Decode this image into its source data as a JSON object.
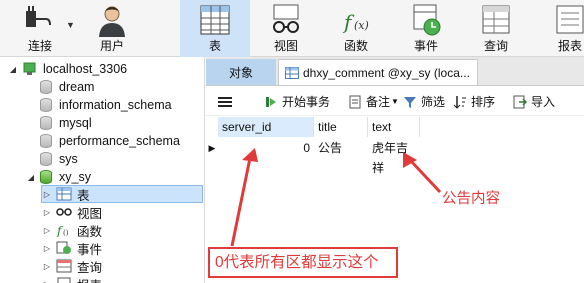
{
  "toolbar": {
    "buttons": [
      {
        "label": "连接",
        "icon": "plug-icon"
      },
      {
        "label": "用户",
        "icon": "user-icon"
      },
      {
        "label": "表",
        "icon": "table-icon"
      },
      {
        "label": "视图",
        "icon": "view-glasses-icon"
      },
      {
        "label": "函数",
        "icon": "function-icon"
      },
      {
        "label": "事件",
        "icon": "event-clock-icon"
      },
      {
        "label": "查询",
        "icon": "query-icon"
      },
      {
        "label": "报表",
        "icon": "report-icon"
      }
    ],
    "active": "表"
  },
  "tree": {
    "connection": "localhost_3306",
    "databases": [
      "dream",
      "information_schema",
      "mysql",
      "performance_schema",
      "sys",
      "xy_sy"
    ],
    "xy_sy_children": [
      "表",
      "视图",
      "函数",
      "事件",
      "查询",
      "报表"
    ]
  },
  "tabs": {
    "objects": "对象",
    "comment": "dhxy_comment @xy_sy (loca..."
  },
  "subtoolbar": {
    "menu_icon": "menu-icon",
    "begin_transaction": "开始事务",
    "note": "备注",
    "filter": "筛选",
    "sort": "排序",
    "import": "导入"
  },
  "grid": {
    "columns": [
      "server_id",
      "title",
      "text"
    ],
    "rows": [
      {
        "server_id": "0",
        "title": "公告",
        "text": "虎年吉祥"
      }
    ]
  },
  "annotations": {
    "box_text": "0代表所有区都显示这个",
    "label_text": "公告内容",
    "color": "#e03a3a"
  },
  "colors": {
    "accent": "#cfe3f8",
    "selected": "#cce4fb",
    "annotation": "#e03a3a"
  }
}
